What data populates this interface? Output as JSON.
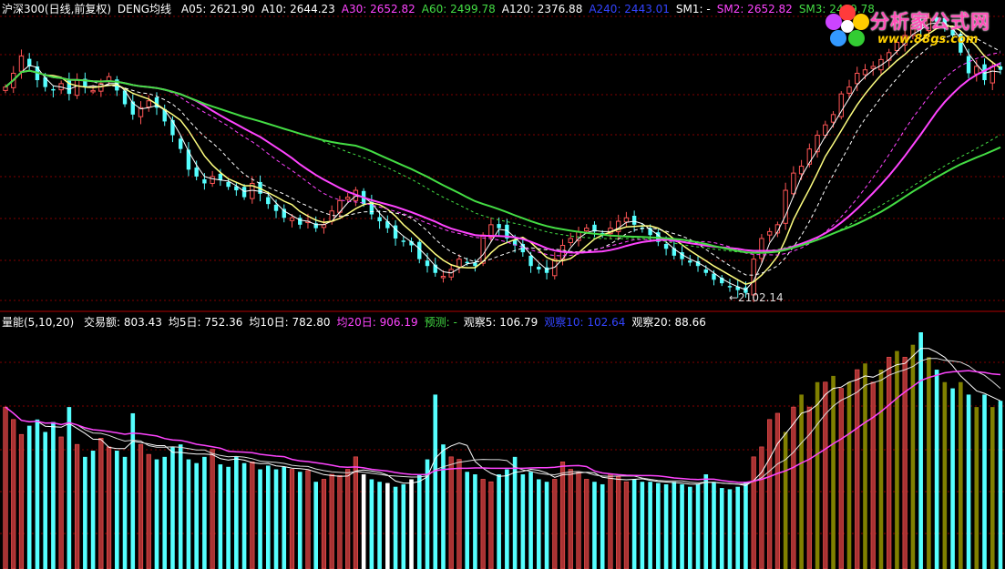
{
  "price_header": {
    "name": "沪深300(日线,前复权)",
    "indicator": "DENG均线",
    "items": [
      {
        "key": "a05",
        "text": "A05: 2621.90",
        "color": "#ffffff"
      },
      {
        "key": "a10",
        "text": "A10: 2644.23",
        "color": "#ffffff"
      },
      {
        "key": "a30",
        "text": "A30: 2652.82",
        "color": "#ff44ff"
      },
      {
        "key": "a60",
        "text": "A60: 2499.78",
        "color": "#44dd44"
      },
      {
        "key": "a120",
        "text": "A120: 2376.88",
        "color": "#ffffff"
      },
      {
        "key": "a240",
        "text": "A240: 2443.01",
        "color": "#3344ff"
      },
      {
        "key": "sm1",
        "text": "SM1: -",
        "color": "#ffffff"
      },
      {
        "key": "sm2",
        "text": "SM2: 2652.82",
        "color": "#ff44ff"
      },
      {
        "key": "sm3",
        "text": "SM3: 2499.78",
        "color": "#44dd44"
      }
    ]
  },
  "volume_header": {
    "name": "量能(5,10,20)",
    "items": [
      {
        "key": "vol",
        "text": "交易额: 803.43",
        "color": "#ffffff"
      },
      {
        "key": "ma5",
        "text": "均5日: 752.36",
        "color": "#ffffff"
      },
      {
        "key": "ma10",
        "text": "均10日: 782.80",
        "color": "#ffffff"
      },
      {
        "key": "ma20",
        "text": "均20日: 906.19",
        "color": "#ff44ff"
      },
      {
        "key": "forecast",
        "text": "预测: -",
        "color": "#44dd44"
      },
      {
        "key": "obs5",
        "text": "观察5: 106.79",
        "color": "#ffffff"
      },
      {
        "key": "obs10",
        "text": "观察10: 102.64",
        "color": "#3344ff"
      },
      {
        "key": "obs20",
        "text": "观察20: 88.66",
        "color": "#ffffff"
      }
    ]
  },
  "low_marker": {
    "text": "←2102.14",
    "value": 2102.14
  },
  "logo": {
    "name": "分析家公式网",
    "url": "www.88gs.com"
  },
  "colors": {
    "up": "#ff5555",
    "down": "#55ffff",
    "olive": "#808000",
    "grid": "#800000"
  },
  "chart_data": [
    {
      "type": "candlestick",
      "ylim": [
        2080,
        2900
      ],
      "close": [
        2700,
        2740,
        2790,
        2760,
        2720,
        2700,
        2690,
        2710,
        2680,
        2720,
        2700,
        2690,
        2710,
        2730,
        2690,
        2650,
        2620,
        2640,
        2660,
        2640,
        2600,
        2560,
        2520,
        2460,
        2440,
        2420,
        2440,
        2430,
        2410,
        2400,
        2380,
        2420,
        2390,
        2360,
        2340,
        2320,
        2320,
        2300,
        2310,
        2290,
        2300,
        2340,
        2370,
        2380,
        2400,
        2360,
        2330,
        2310,
        2290,
        2260,
        2250,
        2240,
        2200,
        2180,
        2160,
        2150,
        2170,
        2200,
        2190,
        2180,
        2270,
        2300,
        2290,
        2260,
        2240,
        2220,
        2180,
        2170,
        2160,
        2200,
        2240,
        2260,
        2280,
        2290,
        2280,
        2270,
        2290,
        2310,
        2320,
        2300,
        2290,
        2270,
        2250,
        2230,
        2210,
        2200,
        2190,
        2180,
        2160,
        2140,
        2130,
        2120,
        2110,
        2102,
        2200,
        2260,
        2280,
        2300,
        2400,
        2450,
        2470,
        2520,
        2560,
        2590,
        2620,
        2680,
        2700,
        2740,
        2750,
        2760,
        2780,
        2800,
        2830,
        2850,
        2880,
        2870,
        2900,
        2890,
        2870,
        2850,
        2800,
        2740,
        2760,
        2720,
        2760,
        2750
      ],
      "ma5_end": 2621.9,
      "ma30_end": 2652.82,
      "ma60_end": 2499.78
    },
    {
      "type": "bar",
      "ylim": [
        0,
        1900
      ],
      "values": [
        1300,
        1200,
        1080,
        1150,
        1200,
        1100,
        1180,
        1060,
        1300,
        1000,
        900,
        950,
        1050,
        980,
        950,
        900,
        1250,
        1000,
        920,
        880,
        900,
        980,
        1000,
        880,
        850,
        900,
        960,
        840,
        820,
        900,
        850,
        860,
        800,
        830,
        800,
        820,
        800,
        780,
        790,
        700,
        720,
        760,
        750,
        800,
        900,
        760,
        720,
        700,
        690,
        660,
        680,
        720,
        760,
        880,
        1400,
        1000,
        900,
        880,
        780,
        760,
        720,
        700,
        760,
        800,
        900,
        760,
        780,
        720,
        700,
        720,
        860,
        800,
        780,
        720,
        700,
        680,
        760,
        740,
        700,
        720,
        700,
        700,
        690,
        680,
        700,
        680,
        660,
        680,
        760,
        700,
        650,
        640,
        660,
        700,
        900,
        980,
        1200,
        1250,
        1100,
        1300,
        1400,
        1300,
        1500,
        1500,
        1550,
        1450,
        1500,
        1600,
        1650,
        1500,
        1600,
        1700,
        1750,
        1700,
        1800,
        1900,
        1700,
        1600,
        1500,
        1450,
        1500,
        1400,
        1300,
        1400,
        1300,
        1350
      ],
      "ma5_end": 752.36,
      "ma10_end": 782.8,
      "ma20_end": 906.19
    }
  ]
}
